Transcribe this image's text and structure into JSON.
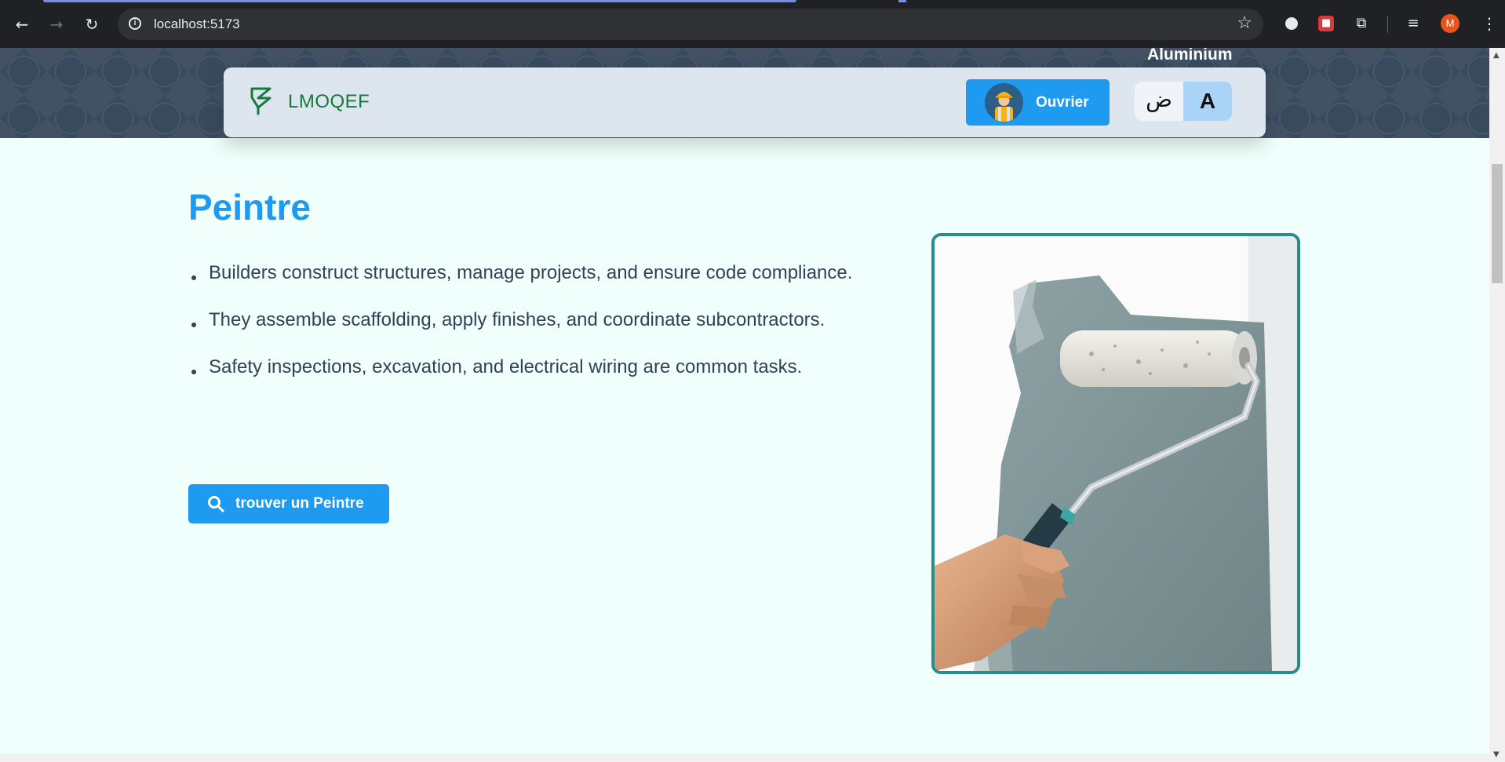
{
  "browser": {
    "url": "localhost:5173",
    "profile_initial": "M",
    "icons": [
      "back-arrow-icon",
      "forward-arrow-icon",
      "reload-icon",
      "site-info-icon",
      "bookmark-star-icon",
      "extension-icon",
      "puzzle-icon",
      "media-control-icon",
      "kebab-menu-icon"
    ]
  },
  "header": {
    "band_label": "Aluminium",
    "brand": "LMOQEF",
    "worker_button_label": "Ouvrier",
    "lang_arabic": "ض",
    "lang_latin": "A"
  },
  "main": {
    "title": "Peintre",
    "features": [
      "Builders construct structures, manage projects, and ensure code compliance.",
      "They assemble scaffolding, apply finishes, and coordinate subcontractors.",
      "Safety inspections, excavation, and electrical wiring are common tasks."
    ],
    "cta_label": "trouver un Peintre"
  },
  "colors": {
    "accent_blue": "#1e9af0",
    "brand_green": "#157a3c",
    "page_background": "#f0fffb",
    "image_border_teal": "#2a8c8c",
    "navbar_background": "#dde5ee"
  }
}
